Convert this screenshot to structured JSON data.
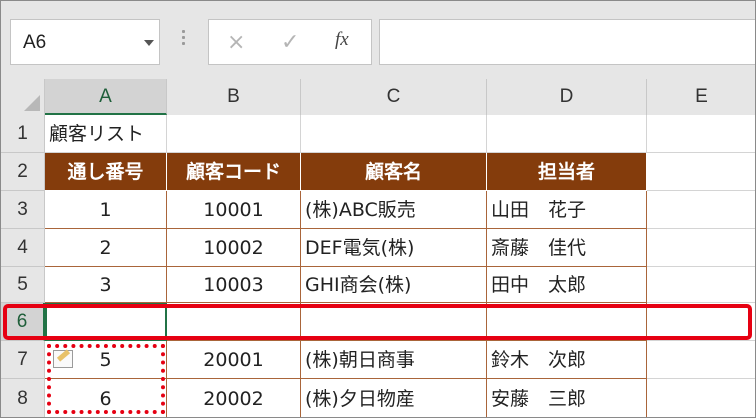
{
  "name_box": {
    "value": "A6"
  },
  "formula_bar": {
    "cancel_icon": "×",
    "enter_icon": "✓",
    "fx_label": "fx",
    "value": ""
  },
  "columns": [
    "A",
    "B",
    "C",
    "D",
    "E"
  ],
  "row_numbers": [
    "1",
    "2",
    "3",
    "4",
    "5",
    "6",
    "7",
    "8"
  ],
  "sheet": {
    "title": "顧客リスト",
    "headers": [
      "通し番号",
      "顧客コード",
      "顧客名",
      "担当者"
    ],
    "rows": [
      {
        "no": "1",
        "code": "10001",
        "name": "(株)ABC販売",
        "staff": "山田　花子"
      },
      {
        "no": "2",
        "code": "10002",
        "name": "DEF電気(株)",
        "staff": "斎藤　佳代"
      },
      {
        "no": "3",
        "code": "10003",
        "name": "GHI商会(株)",
        "staff": "田中　太郎"
      },
      {
        "no": "",
        "code": "",
        "name": "",
        "staff": ""
      },
      {
        "no": "5",
        "code": "20001",
        "name": "(株)朝日商事",
        "staff": "鈴木　次郎"
      },
      {
        "no": "6",
        "code": "20002",
        "name": "(株)夕日物産",
        "staff": "安藤　三郎"
      }
    ]
  },
  "colors": {
    "header_fill": "#843c0c",
    "selection": "#217346",
    "highlight": "#e60012"
  }
}
